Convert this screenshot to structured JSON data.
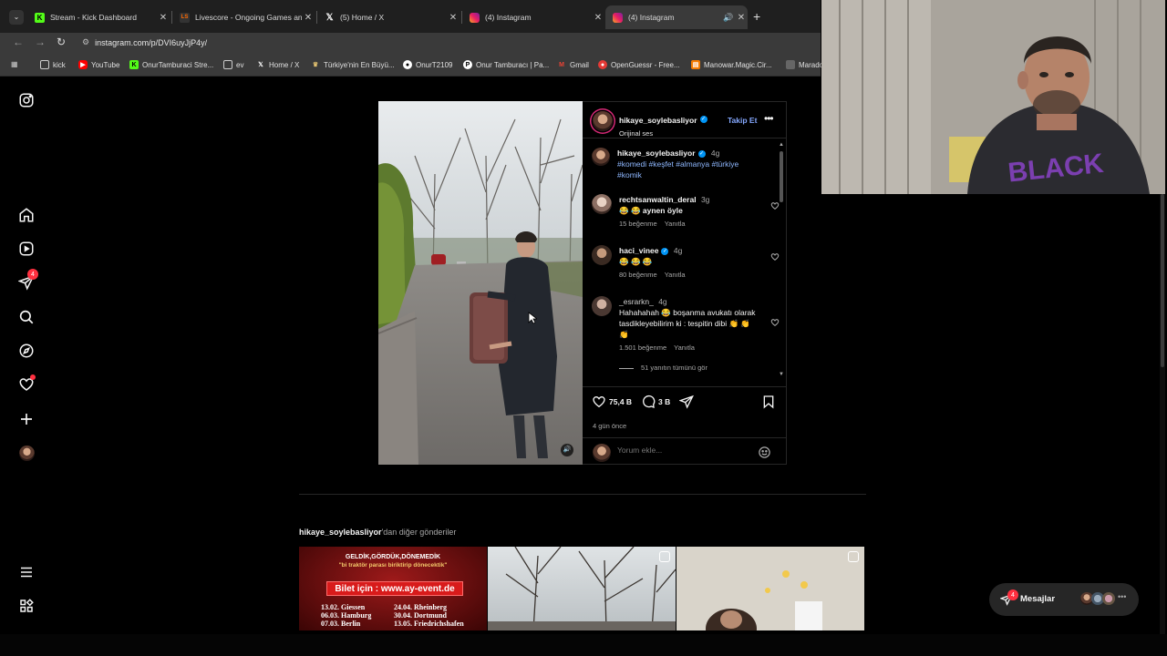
{
  "browser": {
    "tabs": [
      {
        "title": "Stream - Kick Dashboard",
        "icon": "kick-icon"
      },
      {
        "title": "Livescore - Ongoing Games and",
        "icon": "livescore-icon"
      },
      {
        "title": "(5) Home / X",
        "icon": "x-icon"
      },
      {
        "title": "(4) Instagram",
        "icon": "instagram-icon"
      },
      {
        "title": "(4) Instagram",
        "icon": "instagram-icon",
        "active": true
      }
    ],
    "url": "instagram.com/p/DVI6uyJjP4y/",
    "bookmarks": [
      {
        "label": "kick",
        "icon": "folder-icon"
      },
      {
        "label": "YouTube",
        "icon": "youtube-icon"
      },
      {
        "label": "OnurTamburaci Stre...",
        "icon": "kick-icon"
      },
      {
        "label": "ev",
        "icon": "folder-icon"
      },
      {
        "label": "Home / X",
        "icon": "x-icon"
      },
      {
        "label": "Türkiye'nin En Büyü...",
        "icon": "site-icon"
      },
      {
        "label": "OnurT2109",
        "icon": "github-icon"
      },
      {
        "label": "Onur Tamburacı | Pa...",
        "icon": "patreon-icon"
      },
      {
        "label": "Gmail",
        "icon": "gmail-icon"
      },
      {
        "label": "OpenGuessr - Free...",
        "icon": "openguessr-icon"
      },
      {
        "label": "Manowar.Magic.Cir...",
        "icon": "site-icon"
      },
      {
        "label": "Marado",
        "icon": "site-icon"
      }
    ]
  },
  "nav": {
    "notifications_badge": "4"
  },
  "post": {
    "username": "hikaye_soylebasliyor",
    "audio": "Orijinal ses",
    "follow_label": "Takip Et",
    "caption": {
      "username": "hikaye_soylebasliyor",
      "time": "4g",
      "hashtags": "#komedi #keşfet #almanya #türkiye #komik"
    },
    "comments": [
      {
        "username": "rechtsanwaltin_deral",
        "time": "3g",
        "text": "😂 😂 aynen öyle",
        "likes": "15 beğenme",
        "reply": "Yanıtla"
      },
      {
        "username": "haci_vinee",
        "time": "4g",
        "text": "😂 😂 😂",
        "likes": "80 beğenme",
        "reply": "Yanıtla",
        "verified": true
      },
      {
        "username": "_esrarkn_",
        "time": "4g",
        "text": "Hahahahah 😂 boşanma avukatı olarak tasdikleyebilirim ki : tespitin dibi 👏 👏 👏",
        "likes": "1.501 beğenme",
        "reply": "Yanıtla"
      }
    ],
    "view_replies": "51 yanıtın tümünü gör",
    "like_count": "75,4 B",
    "comment_count": "3 B",
    "posted": "4 gün önce",
    "comment_placeholder": "Yorum ekle..."
  },
  "more_posts": {
    "username": "hikaye_soylebasliyor",
    "suffix": "'dan diğer gönderiler",
    "poster": {
      "line1": "GELDİK,GÖRDÜK,DÖNEMEDİK",
      "line2": "\"bi traktör parası biriktirip dönecektik\"",
      "ticket": "Bilet için : www.ay-event.de",
      "dates_left": [
        "13.02. Giessen",
        "06.03. Hamburg",
        "07.03. Berlin"
      ],
      "dates_right": [
        "24.04. Rheinberg",
        "30.04. Dortmund",
        "13.05. Friedrichshafen"
      ]
    }
  },
  "messages": {
    "label": "Mesajlar",
    "badge": "4"
  },
  "colors": {
    "accent": "#0095f6",
    "badge": "#ff3040",
    "background": "#000000"
  }
}
